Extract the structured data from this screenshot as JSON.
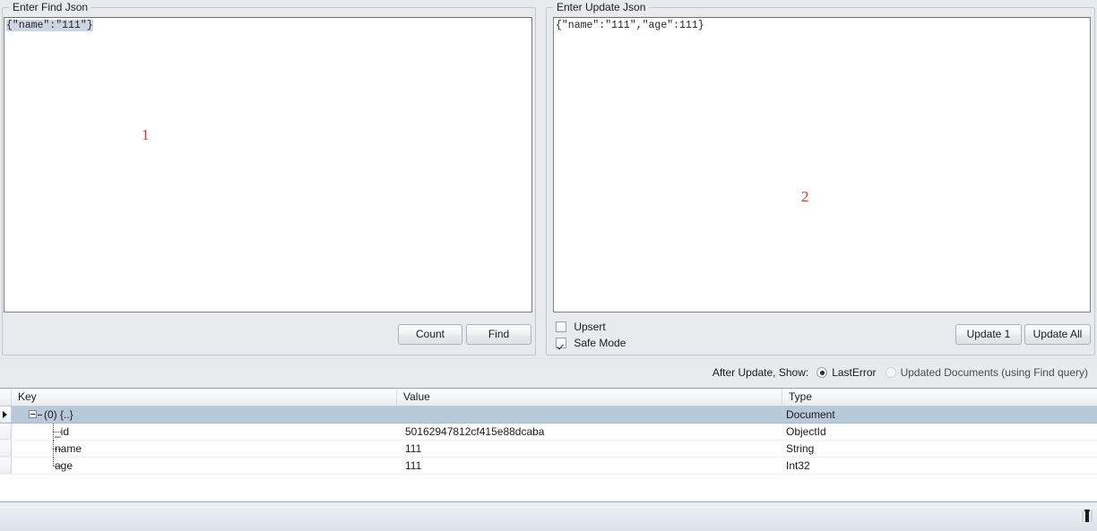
{
  "find_panel": {
    "caption": "Enter Find Json",
    "editor_text": "{\"name\":\"111\"}",
    "annotation": "1",
    "count_label": "Count",
    "find_label": "Find"
  },
  "update_panel": {
    "caption": "Enter Update Json",
    "editor_text": "{\"name\":\"111\",\"age\":111}",
    "annotation": "2",
    "upsert_label": "Upsert",
    "upsert_checked": false,
    "safe_mode_label": "Safe Mode",
    "safe_mode_checked": true,
    "update_one_label": "Update 1",
    "update_all_label": "Update All"
  },
  "after_update": {
    "label": "After Update, Show:",
    "options": [
      {
        "label": "LastError",
        "selected": true
      },
      {
        "label": "Updated Documents (using Find query)",
        "selected": false
      }
    ]
  },
  "grid": {
    "columns": [
      "Key",
      "Value",
      "Type"
    ],
    "rows": [
      {
        "key": "(0) {..}",
        "value": "",
        "type": "Document",
        "level": 0,
        "selected": true,
        "expanded": true
      },
      {
        "key": "_id",
        "value": "50162947812cf415e88dcaba",
        "type": "ObjectId",
        "level": 1,
        "selected": false
      },
      {
        "key": "name",
        "value": "111",
        "type": "String",
        "level": 1,
        "selected": false
      },
      {
        "key": "age",
        "value": "111",
        "type": "Int32",
        "level": 1,
        "selected": false,
        "last": true
      }
    ]
  },
  "colors": {
    "window_bg": "#e7ebee",
    "annotation_red": "#e03030",
    "selection_blue": "#b8cada",
    "text_selection": "#cdd6e3",
    "editor_bg": "#ffffff"
  }
}
